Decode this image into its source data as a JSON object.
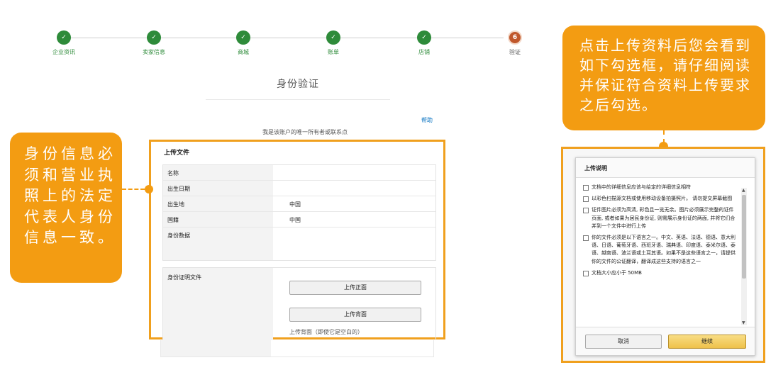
{
  "steps": [
    {
      "label": "企业资讯",
      "state": "done",
      "mark": "✓"
    },
    {
      "label": "卖家信息",
      "state": "done",
      "mark": "✓"
    },
    {
      "label": "商城",
      "state": "done",
      "mark": "✓"
    },
    {
      "label": "账单",
      "state": "done",
      "mark": "✓"
    },
    {
      "label": "店铺",
      "state": "done",
      "mark": "✓"
    },
    {
      "label": "验证",
      "state": "active",
      "mark": "6"
    }
  ],
  "page": {
    "title": "身份验证",
    "help": "帮助",
    "owner_text": "我是该账户的唯一所有者或联系点"
  },
  "form": {
    "heading": "上传文件",
    "rows": [
      {
        "label": "名称",
        "value": ""
      },
      {
        "label": "出生日期",
        "value": ""
      },
      {
        "label": "出生地",
        "value": "中国"
      },
      {
        "label": "国籍",
        "value": "中国"
      },
      {
        "label": "身份数据",
        "value": ""
      }
    ],
    "doc_label": "身份证明文件",
    "upload_front": "上传正面",
    "upload_back": "上传背面",
    "back_note": "上传背面（即使它是空白的）"
  },
  "callout_left": "身份信息必须和营业执照上的法定代表人身份信息一致。",
  "callout_right": "点击上传资料后您会看到如下勾选框，请仔细阅读并保证符合资料上传要求之后勾选。",
  "dialog": {
    "title": "上传说明",
    "items": [
      "文档中的详细信息应该与给定的详细信息相符",
      "以彩色扫描源文档或使用移动设备拍摄照片。 请勿提交屏幕截图",
      "证件图片必须为高清, 彩色且一览无余。图片必须展示完整的证件页面, 或者如果为居民身份证, 则需展示身份证的两面, 并将它们合并到一个文件中进行上传",
      "你的文件必须是以下语言之一。中文、英语、法语、德语、意大利语、日语、葡萄牙语、西班牙语、瑞典语、印度语、泰米尔语、泰语、越南语、波兰语或土耳其语。如果不是这些语言之一，请提供你的文件的公证翻译，翻译成这些支持的语言之一",
      "文档大小应小于 50MB"
    ],
    "cancel": "取消",
    "continue": "继续"
  },
  "colors": {
    "accent": "#f39c12",
    "step_done": "#2e8b3a",
    "step_active": "#c0572b",
    "link": "#0b74c2"
  }
}
